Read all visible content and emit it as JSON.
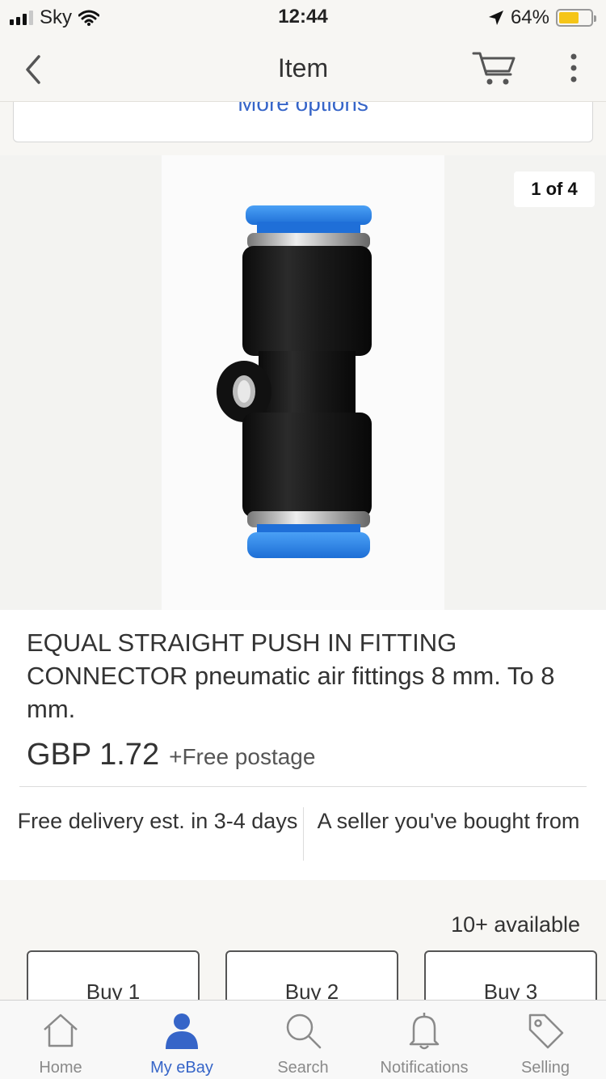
{
  "status_bar": {
    "carrier": "Sky",
    "time": "12:44",
    "battery_percent": "64%",
    "battery_level": 0.64,
    "icons": [
      "signal-icon",
      "wifi-icon",
      "location-arrow-icon",
      "battery-icon"
    ]
  },
  "nav": {
    "title": "Item",
    "icons": [
      "back-chevron-icon",
      "cart-icon",
      "more-vertical-icon"
    ]
  },
  "more_options": {
    "label": "More options"
  },
  "gallery": {
    "counter": "1 of 4",
    "image_icon": "push-fitting-product-photo"
  },
  "item": {
    "title": "EQUAL STRAIGHT PUSH IN FITTING CONNECTOR pneumatic air fittings 8 mm. To 8 mm.",
    "price": "GBP 1.72",
    "shipping": "+Free postage",
    "feature_delivery": "Free delivery est. in 3-4 days",
    "feature_seller": "A seller you've bought from"
  },
  "buy": {
    "availability": "10+ available",
    "buttons": [
      "Buy 1",
      "Buy 2",
      "Buy 3"
    ]
  },
  "tabbar": {
    "tabs": [
      {
        "label": "Home",
        "icon": "home-icon",
        "active": false
      },
      {
        "label": "My eBay",
        "icon": "user-icon",
        "active": true
      },
      {
        "label": "Search",
        "icon": "search-icon",
        "active": false
      },
      {
        "label": "Notifications",
        "icon": "bell-icon",
        "active": false
      },
      {
        "label": "Selling",
        "icon": "tag-icon",
        "active": false
      }
    ]
  },
  "colors": {
    "accent": "#3665c8",
    "battery": "#f5c518",
    "fitting_blue": "#2a7fe0"
  }
}
